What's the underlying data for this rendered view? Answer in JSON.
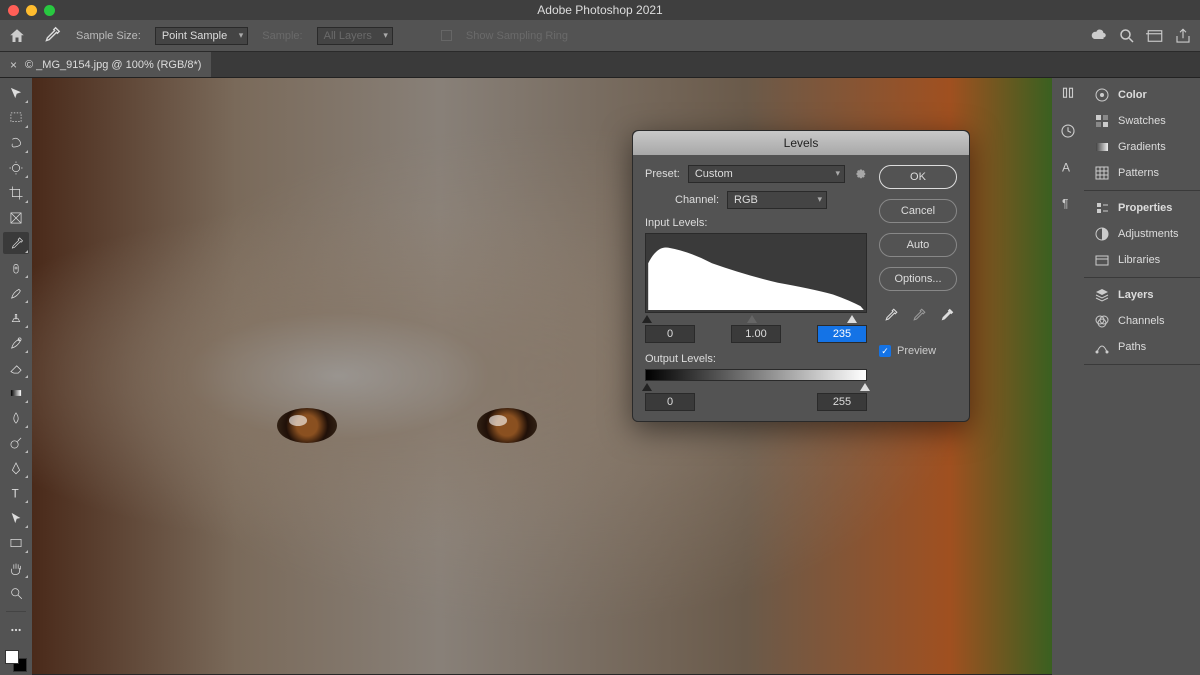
{
  "app": {
    "title": "Adobe Photoshop 2021"
  },
  "options_bar": {
    "sample_size_label": "Sample Size:",
    "sample_size_value": "Point Sample",
    "sample_label": "Sample:",
    "sample_value": "All Layers",
    "show_sampling_ring": "Show Sampling Ring"
  },
  "tab": {
    "title": "© _MG_9154.jpg @ 100% (RGB/8*)",
    "close": "×"
  },
  "tools": [
    {
      "name": "move-tool",
      "tri": true
    },
    {
      "name": "marquee-tool",
      "tri": true
    },
    {
      "name": "lasso-tool",
      "tri": true
    },
    {
      "name": "quick-select-tool",
      "tri": true
    },
    {
      "name": "crop-tool",
      "tri": true
    },
    {
      "name": "frame-tool",
      "tri": false
    },
    {
      "name": "eyedropper-tool",
      "tri": true,
      "active": true
    },
    {
      "name": "healing-brush-tool",
      "tri": true
    },
    {
      "name": "brush-tool",
      "tri": true
    },
    {
      "name": "clone-stamp-tool",
      "tri": true
    },
    {
      "name": "history-brush-tool",
      "tri": true
    },
    {
      "name": "eraser-tool",
      "tri": true
    },
    {
      "name": "gradient-tool",
      "tri": true
    },
    {
      "name": "blur-tool",
      "tri": true
    },
    {
      "name": "dodge-tool",
      "tri": true
    },
    {
      "name": "pen-tool",
      "tri": true
    },
    {
      "name": "type-tool",
      "tri": true
    },
    {
      "name": "path-select-tool",
      "tri": true
    },
    {
      "name": "rectangle-tool",
      "tri": true
    },
    {
      "name": "hand-tool",
      "tri": true
    },
    {
      "name": "zoom-tool",
      "tri": false
    }
  ],
  "panels": {
    "group1": [
      {
        "name": "color",
        "label": "Color",
        "bold": true
      },
      {
        "name": "swatches",
        "label": "Swatches"
      },
      {
        "name": "gradients",
        "label": "Gradients"
      },
      {
        "name": "patterns",
        "label": "Patterns"
      }
    ],
    "group2": [
      {
        "name": "properties",
        "label": "Properties",
        "bold": true
      },
      {
        "name": "adjustments",
        "label": "Adjustments"
      },
      {
        "name": "libraries",
        "label": "Libraries"
      }
    ],
    "group3": [
      {
        "name": "layers",
        "label": "Layers",
        "bold": true
      },
      {
        "name": "channels",
        "label": "Channels"
      },
      {
        "name": "paths",
        "label": "Paths"
      }
    ]
  },
  "dialog": {
    "title": "Levels",
    "preset_label": "Preset:",
    "preset_value": "Custom",
    "channel_label": "Channel:",
    "channel_value": "RGB",
    "input_label": "Input Levels:",
    "output_label": "Output Levels:",
    "input_black": "0",
    "input_gamma": "1.00",
    "input_white": "235",
    "output_black": "0",
    "output_white": "255",
    "ok": "OK",
    "cancel": "Cancel",
    "auto": "Auto",
    "options": "Options...",
    "preview": "Preview"
  }
}
